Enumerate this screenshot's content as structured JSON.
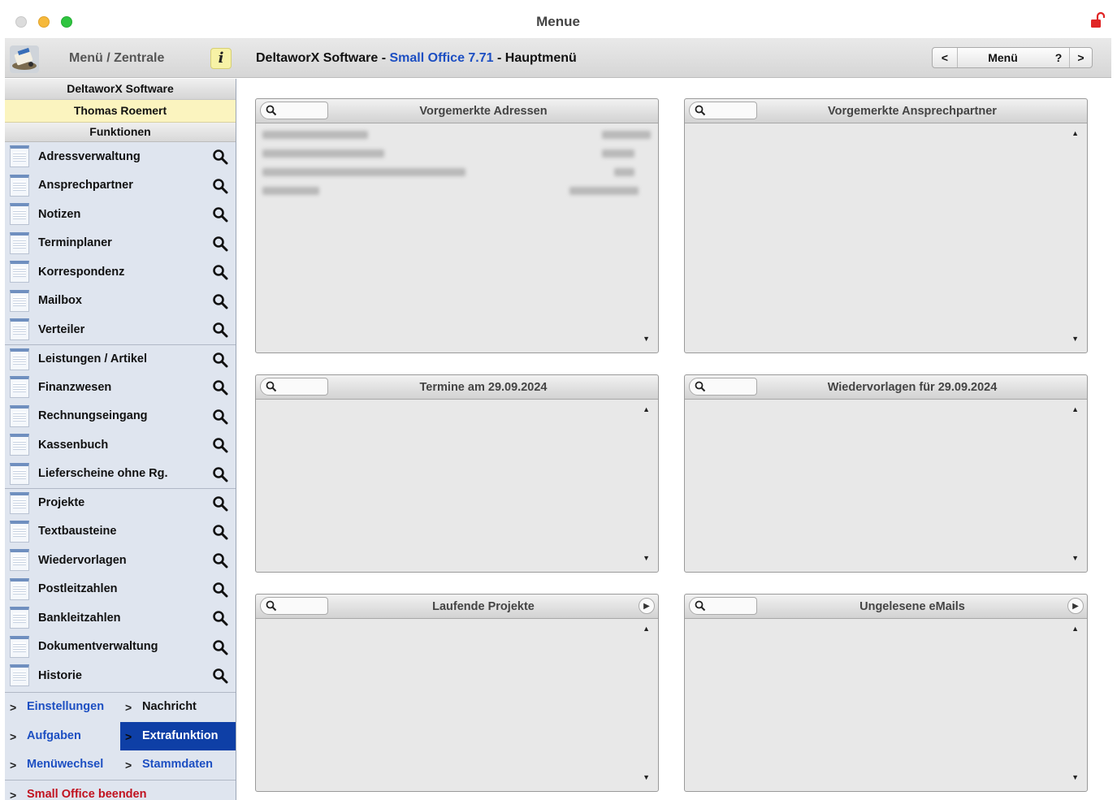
{
  "window": {
    "title": "Menue"
  },
  "toolbar": {
    "menu_title": "Menü / Zentrale",
    "info_label": "i",
    "header_prefix": "DeltaworX Software - ",
    "header_product": "Small Office 7.71",
    "header_suffix": " - Hauptmenü",
    "nav_prev": "<",
    "nav_menu": "Menü",
    "nav_help": "?",
    "nav_next": ">"
  },
  "sidebar": {
    "company": "DeltaworX Software",
    "user": "Thomas Roemert",
    "section": "Funktionen",
    "items": [
      {
        "label": "Adressverwaltung"
      },
      {
        "label": "Ansprechpartner"
      },
      {
        "label": "Notizen"
      },
      {
        "label": "Terminplaner"
      },
      {
        "label": "Korrespondenz"
      },
      {
        "label": "Mailbox"
      },
      {
        "label": "Verteiler"
      },
      {
        "label": "Leistungen / Artikel"
      },
      {
        "label": "Finanzwesen"
      },
      {
        "label": "Rechnungseingang"
      },
      {
        "label": "Kassenbuch"
      },
      {
        "label": "Lieferscheine ohne Rg."
      },
      {
        "label": "Projekte"
      },
      {
        "label": "Textbausteine"
      },
      {
        "label": "Wiedervorlagen"
      },
      {
        "label": "Postleitzahlen"
      },
      {
        "label": "Bankleitzahlen"
      },
      {
        "label": "Dokumentverwaltung"
      },
      {
        "label": "Historie"
      }
    ],
    "links": {
      "einstellungen": "Einstellungen",
      "nachricht": "Nachricht",
      "aufgaben": "Aufgaben",
      "extrafunktion": "Extrafunktion",
      "menuewechsel": "Menüwechsel",
      "stammdaten": "Stammdaten",
      "beenden": "Small Office beenden"
    },
    "chevron": ">"
  },
  "panels": {
    "adressen": {
      "title": "Vorgemerkte Adressen"
    },
    "ansprechpartner": {
      "title": "Vorgemerkte Ansprechpartner"
    },
    "termine": {
      "title": "Termine am 29.09.2024"
    },
    "wiedervorlagen": {
      "title": "Wiedervorlagen für 29.09.2024"
    },
    "projekte": {
      "title": "Laufende Projekte"
    },
    "emails": {
      "title": "Ungelesene eMails"
    }
  },
  "icons": {
    "scroll_up": "▲",
    "scroll_down": "▼",
    "panel_arrow": "▶"
  },
  "colors": {
    "accent_blue": "#1d4fc2",
    "highlight": "#0e3fa6",
    "user_bg": "#fbf4bf",
    "quit_red": "#c1121f",
    "lock_red": "#e02424"
  }
}
